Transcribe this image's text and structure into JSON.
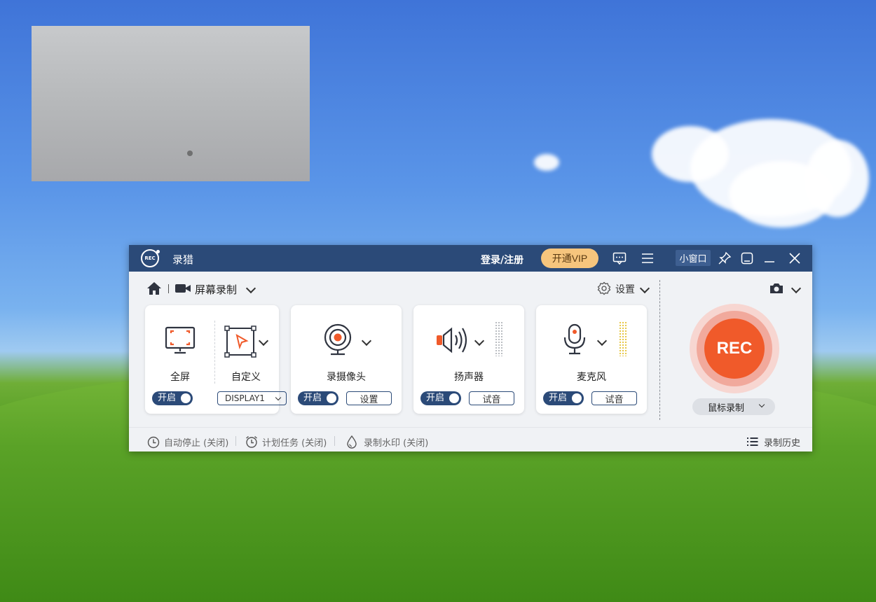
{
  "app": {
    "name": "录猎",
    "logo_text": "REC",
    "login_label": "登录/注册",
    "vip_label": "开通VIP",
    "mini_window_label": "小窗口",
    "breadcrumb_label": "屏幕录制",
    "settings_label": "设置"
  },
  "cards": {
    "fullscreen": {
      "label": "全屏",
      "toggle": "开启",
      "display": "DISPLAY1"
    },
    "custom": {
      "label": "自定义"
    },
    "webcam": {
      "label": "录摄像头",
      "toggle": "开启",
      "button": "设置"
    },
    "speaker": {
      "label": "扬声器",
      "toggle": "开启",
      "button": "试音"
    },
    "mic": {
      "label": "麦克风",
      "toggle": "开启",
      "button": "试音"
    }
  },
  "rec": {
    "label": "REC",
    "mode": "鼠标录制"
  },
  "footer": {
    "auto_stop": "自动停止 (关闭)",
    "schedule": "计划任务 (关闭)",
    "watermark": "录制水印 (关闭)",
    "history": "录制历史"
  },
  "colors": {
    "titlebar": "#2b4a78",
    "accent": "#f05a2a",
    "vip": "#f6c57d"
  }
}
